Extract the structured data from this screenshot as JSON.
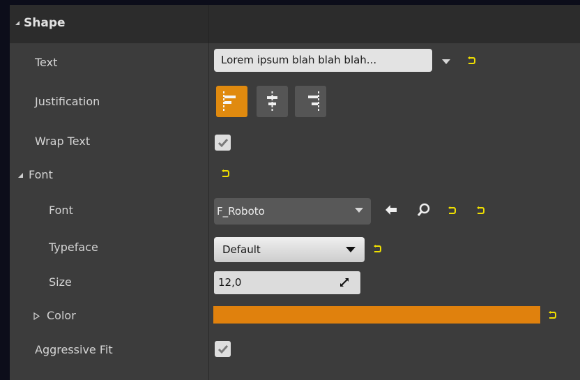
{
  "section": {
    "title": "Shape"
  },
  "rows": {
    "text": {
      "label": "Text",
      "value": "Lorem ipsum blah blah blah..."
    },
    "justification": {
      "label": "Justification",
      "options": [
        "left",
        "center",
        "right"
      ],
      "selected": "left"
    },
    "wrap_text": {
      "label": "Wrap Text",
      "checked": true
    },
    "font_group": {
      "label": "Font"
    },
    "font": {
      "label": "Font",
      "value": "F_Roboto"
    },
    "typeface": {
      "label": "Typeface",
      "value": "Default"
    },
    "size": {
      "label": "Size",
      "value": "12,0"
    },
    "color": {
      "label": "Color",
      "value": "#e0810d"
    },
    "aggressive_fit": {
      "label": "Aggressive Fit",
      "checked": true
    }
  },
  "icons": {
    "reset": "reset-to-default-icon",
    "use_selected": "arrow-left-icon",
    "browse": "search-icon",
    "combo": "chevron-down-icon",
    "check": "checkmark-icon",
    "expand": "expand-triangle-icon"
  },
  "colors": {
    "accent": "#e08a0f",
    "reset_icon": "#f0e000",
    "panel": "#3c3c3c",
    "header": "#2c2c2c"
  }
}
